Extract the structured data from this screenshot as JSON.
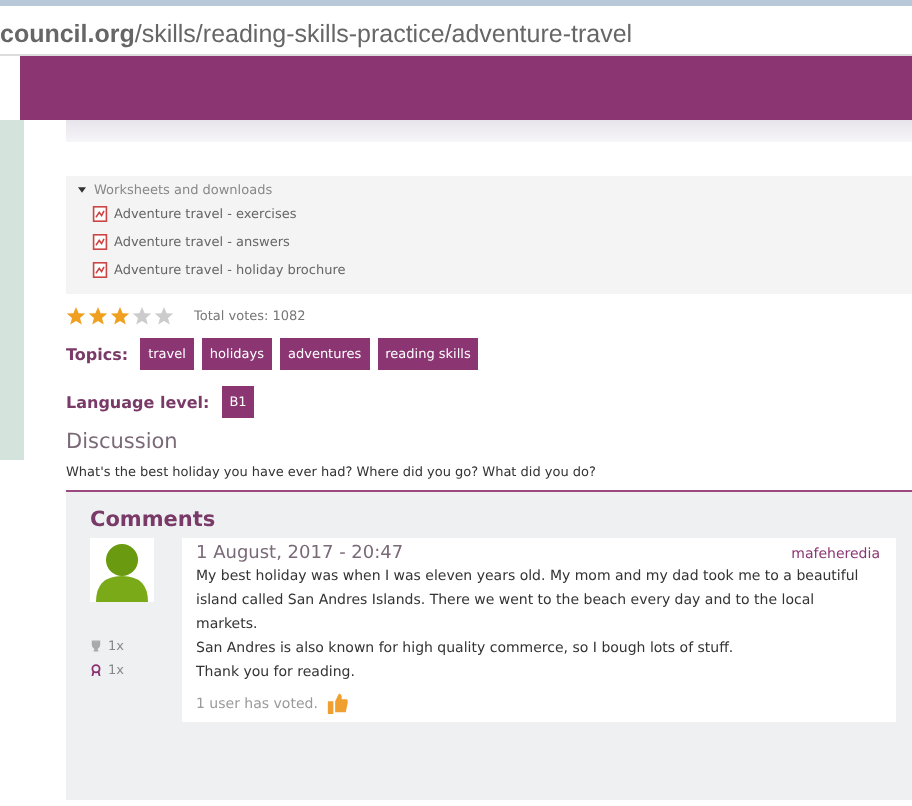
{
  "address_bar": {
    "url": "**council.org**/skills/reading-skills-practice/adventure-travel"
  },
  "downloads": {
    "title": "Worksheets and downloads",
    "expanded": true,
    "items": [
      {
        "label": "Adventure travel - exercises"
      },
      {
        "label": "Adventure travel - answers"
      },
      {
        "label": "Adventure travel - holiday brochure"
      }
    ]
  },
  "rating": {
    "stars": 3,
    "votes": "Total votes: 1082"
  },
  "topics": {
    "label": "Topics:",
    "tags": [
      "travel",
      "holidays",
      "adventures",
      "reading skills"
    ]
  },
  "language_level": {
    "label": "Language level:",
    "value": "B1"
  },
  "discussion": {
    "title": "Discussion",
    "question": "What's the best holiday you have ever had? Where did you go? What did you do?"
  },
  "comments": {
    "title": "Comments",
    "items": [
      {
        "date": "1 August, 2017 - 20:47",
        "author": "mafeheredia",
        "trophies": "1x",
        "badges": "1x",
        "paragraphs": [
          "My best holiday was when I was eleven years old. My mom and my dad took me to a beautiful island called San Andres Islands. There we went to the beach every day and to the local markets.",
          "San Andres is also known for high quality commerce, so I bough lots of stuff.",
          "Thank you for reading."
        ],
        "votes": "1 user has voted."
      }
    ]
  }
}
